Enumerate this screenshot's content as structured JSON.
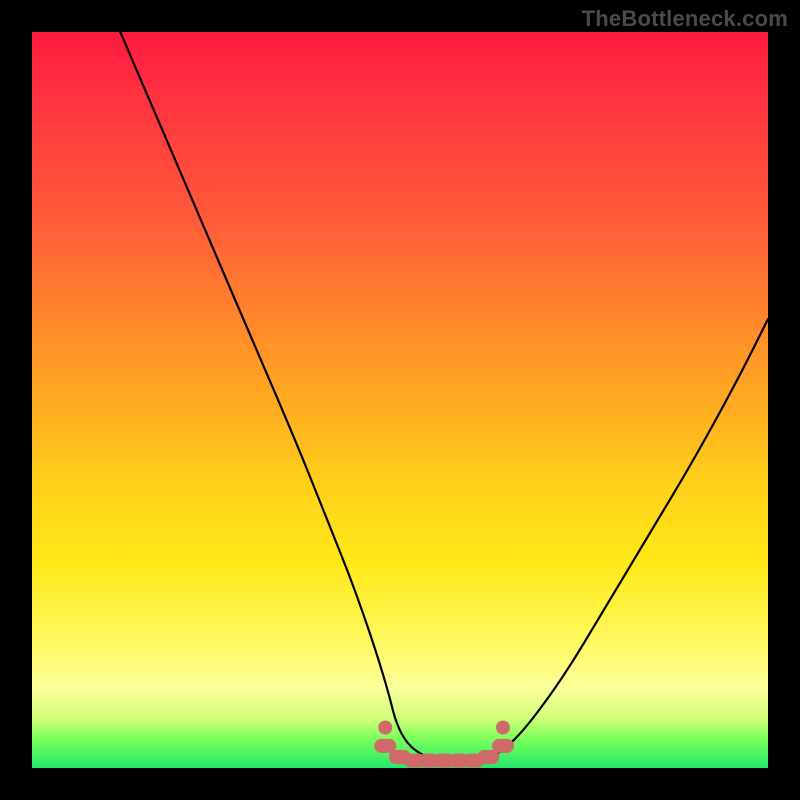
{
  "watermark": "TheBottleneck.com",
  "colors": {
    "frame": "#000000",
    "gradient_top": "#ff1a3f",
    "gradient_mid": "#ffd21a",
    "gradient_bottom": "#23e86b",
    "curve": "#000000",
    "marker": "#d06a6a"
  },
  "chart_data": {
    "type": "line",
    "title": "",
    "xlabel": "",
    "ylabel": "",
    "xlim": [
      0,
      100
    ],
    "ylim": [
      0,
      100
    ],
    "series": [
      {
        "name": "bottleneck-curve",
        "x": [
          12,
          18,
          24,
          30,
          36,
          40,
          44,
          48,
          50,
          54,
          58,
          62,
          66,
          72,
          78,
          84,
          90,
          96,
          100
        ],
        "y": [
          100,
          86,
          72,
          58,
          44,
          34,
          24,
          12,
          4,
          1,
          1,
          1,
          4,
          12,
          22,
          32,
          42,
          53,
          61
        ]
      }
    ],
    "markers": {
      "name": "flat-valley-highlight",
      "x": [
        48,
        50,
        52,
        54,
        56,
        58,
        60,
        62,
        64
      ],
      "y": [
        3,
        1.5,
        1,
        1,
        1,
        1,
        1,
        1.5,
        3
      ]
    }
  }
}
